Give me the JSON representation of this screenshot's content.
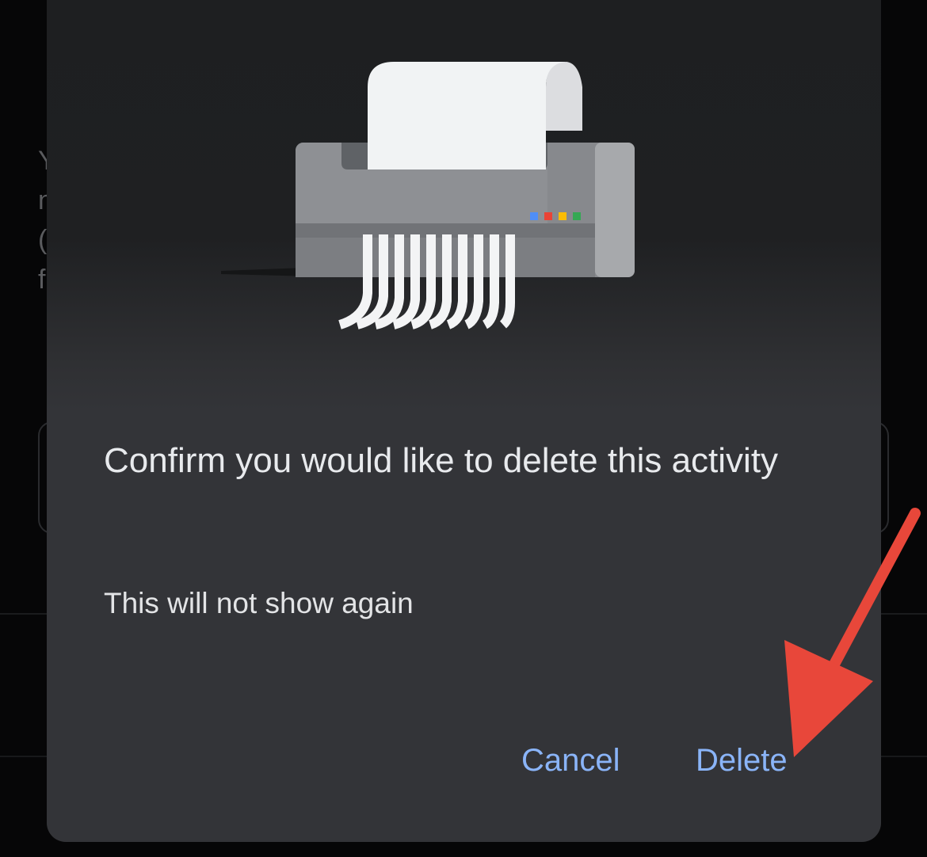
{
  "dialog": {
    "title": "Confirm you would like to delete this activity",
    "message": "This will not show again",
    "cancel_label": "Cancel",
    "delete_label": "Delete",
    "illustration_icon": "paper-shredder-icon"
  },
  "annotation": {
    "icon": "arrow-pointer-icon",
    "color": "#e8473a"
  },
  "colors": {
    "dialog_background": "#333438",
    "button_text": "#8ab4f8",
    "title_text": "#e8eaed"
  }
}
